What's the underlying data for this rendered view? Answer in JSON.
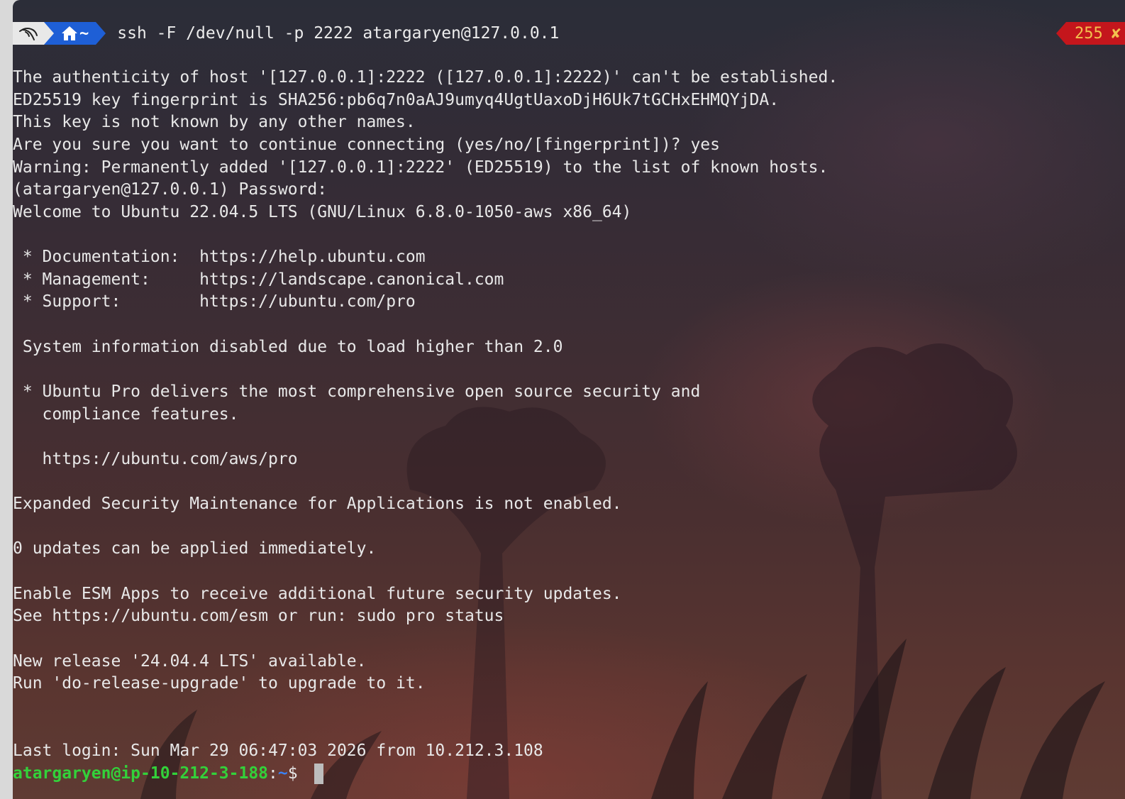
{
  "prompt_bar": {
    "os_icon": "kali-dragon-icon",
    "dir_icon": "home-icon",
    "dir_text": "~",
    "command": "ssh -F /dev/null -p 2222 atargaryen@127.0.0.1"
  },
  "status": {
    "exit_code": "255",
    "error_mark": "✘",
    "color": "#c4161c",
    "text_color": "#f2c14e"
  },
  "output_lines": [
    "The authenticity of host '[127.0.0.1]:2222 ([127.0.0.1]:2222)' can't be established.",
    "ED25519 key fingerprint is SHA256:pb6q7n0aAJ9umyq4UgtUaxoDjH6Uk7tGCHxEHMQYjDA.",
    "This key is not known by any other names.",
    "Are you sure you want to continue connecting (yes/no/[fingerprint])? yes",
    "Warning: Permanently added '[127.0.0.1]:2222' (ED25519) to the list of known hosts.",
    "(atargaryen@127.0.0.1) Password:",
    "Welcome to Ubuntu 22.04.5 LTS (GNU/Linux 6.8.0-1050-aws x86_64)",
    "",
    " * Documentation:  https://help.ubuntu.com",
    " * Management:     https://landscape.canonical.com",
    " * Support:        https://ubuntu.com/pro",
    "",
    " System information disabled due to load higher than 2.0",
    "",
    " * Ubuntu Pro delivers the most comprehensive open source security and",
    "   compliance features.",
    "",
    "   https://ubuntu.com/aws/pro",
    "",
    "Expanded Security Maintenance for Applications is not enabled.",
    "",
    "0 updates can be applied immediately.",
    "",
    "Enable ESM Apps to receive additional future security updates.",
    "See https://ubuntu.com/esm or run: sudo pro status",
    "",
    "New release '24.04.4 LTS' available.",
    "Run 'do-release-upgrade' to upgrade to it.",
    "",
    "",
    "Last login: Sun Mar 29 06:47:03 2026 from 10.212.3.108"
  ],
  "final_prompt": {
    "user_host": "atargaryen@ip-10-212-3-188",
    "colon": ":",
    "path": "~",
    "symbol": "$ ",
    "user_color": "#33d13a",
    "path_color": "#3b82f6"
  },
  "theme": {
    "dir_segment_color": "#1e5fd6",
    "os_segment_color": "#e8e8e8"
  }
}
